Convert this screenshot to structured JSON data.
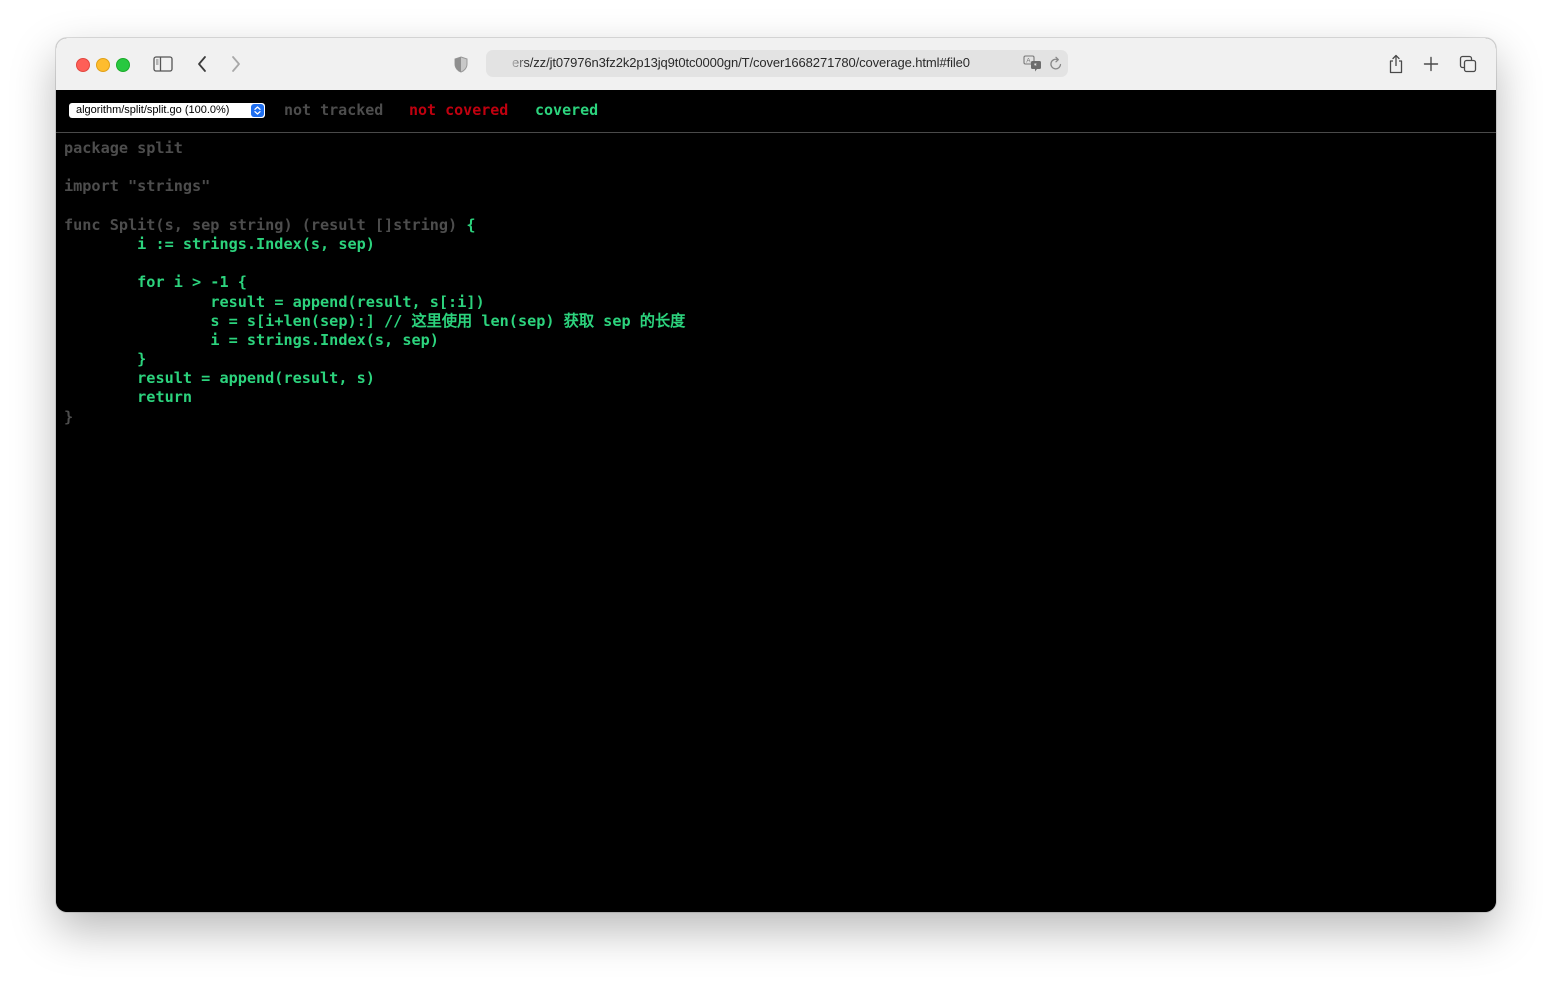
{
  "browser": {
    "url": "ers/zz/jt07976n3fz2k2p13jq9t0tc0000gn/T/cover1668271780/coverage.html#file0",
    "icons": {
      "sidebar": "sidebar-icon",
      "back": "chevron-left-icon",
      "forward": "chevron-right-icon",
      "privacy": "shield-icon",
      "translate": "translate-icon",
      "reload": "reload-icon",
      "share": "share-icon",
      "new_tab": "plus-icon",
      "tab_overview": "tabs-icon"
    }
  },
  "coverage": {
    "file_select": {
      "selected": "algorithm/split/split.go (100.0%)"
    },
    "legend": {
      "not_tracked": "not tracked",
      "not_covered": "not covered",
      "covered": "covered"
    },
    "colors": {
      "not_tracked": "#4d4d4d",
      "not_covered": "#c0000f",
      "covered": "#2cd37d",
      "background": "#000000"
    },
    "code_lines": [
      {
        "segments": [
          {
            "text": "package split",
            "status": "not_tracked"
          }
        ]
      },
      {
        "segments": [
          {
            "text": "",
            "status": "not_tracked"
          }
        ]
      },
      {
        "segments": [
          {
            "text": "import \"strings\"",
            "status": "not_tracked"
          }
        ]
      },
      {
        "segments": [
          {
            "text": "",
            "status": "not_tracked"
          }
        ]
      },
      {
        "segments": [
          {
            "text": "func Split(s, sep string) (result []string) ",
            "status": "not_tracked"
          },
          {
            "text": "{",
            "status": "covered"
          }
        ]
      },
      {
        "segments": [
          {
            "text": "\ti := strings.Index(s, sep)",
            "status": "covered"
          }
        ]
      },
      {
        "segments": [
          {
            "text": "",
            "status": "covered"
          }
        ]
      },
      {
        "segments": [
          {
            "text": "\tfor i > -1 {",
            "status": "covered"
          }
        ]
      },
      {
        "segments": [
          {
            "text": "\t\tresult = append(result, s[:i])",
            "status": "covered"
          }
        ]
      },
      {
        "segments": [
          {
            "text": "\t\ts = s[i+len(sep):] // 这里使用 len(sep) 获取 sep 的长度",
            "status": "covered"
          }
        ]
      },
      {
        "segments": [
          {
            "text": "\t\ti = strings.Index(s, sep)",
            "status": "covered"
          }
        ]
      },
      {
        "segments": [
          {
            "text": "\t}",
            "status": "covered"
          }
        ]
      },
      {
        "segments": [
          {
            "text": "\tresult = append(result, s)",
            "status": "covered"
          }
        ]
      },
      {
        "segments": [
          {
            "text": "\treturn",
            "status": "covered"
          }
        ]
      },
      {
        "segments": [
          {
            "text": "}",
            "status": "not_tracked"
          }
        ]
      }
    ]
  }
}
